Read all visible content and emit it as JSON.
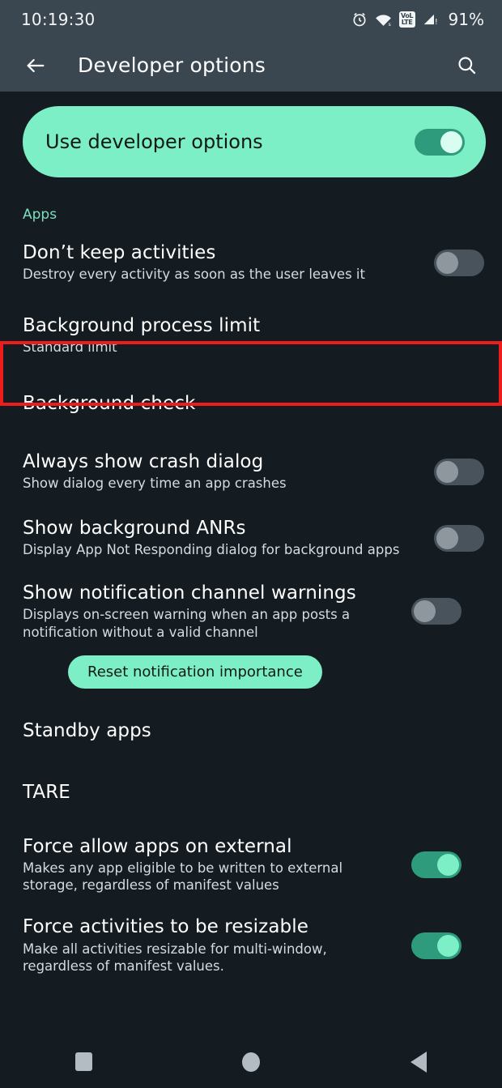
{
  "status_bar": {
    "time": "10:19:30",
    "battery": "91%",
    "icons": [
      "alarm-icon",
      "wifi-icon",
      "volte-icon",
      "signal-icon"
    ],
    "volte_top": "VoL",
    "volte_bottom": "LTE"
  },
  "app_bar": {
    "back_icon": "back-arrow-icon",
    "title": "Developer options",
    "search_icon": "search-icon"
  },
  "master_toggle": {
    "label": "Use developer options",
    "state": "on"
  },
  "sections": [
    {
      "header": "Apps"
    }
  ],
  "rows": [
    {
      "title": "Don’t keep activities",
      "summary": "Destroy every activity as soon as the user leaves it",
      "toggle": "off"
    },
    {
      "title": "Background process limit",
      "summary": "Standard limit",
      "toggle": "none",
      "highlighted": true
    },
    {
      "title": "Background check",
      "summary": "",
      "toggle": "none"
    },
    {
      "title": "Always show crash dialog",
      "summary": "Show dialog every time an app crashes",
      "toggle": "off"
    },
    {
      "title": "Show background ANRs",
      "summary": "Display App Not Responding dialog for background apps",
      "toggle": "off"
    },
    {
      "title": "Show notification channel warnings",
      "summary": "Displays on-screen warning when an app posts a notification without a valid channel",
      "toggle": "off"
    },
    {
      "title": "Standby apps",
      "summary": "",
      "toggle": "none"
    },
    {
      "title": "TARE",
      "summary": "",
      "toggle": "none"
    },
    {
      "title": "Force allow apps on external",
      "summary": "Makes any app eligible to be written to external storage, regardless of manifest values",
      "toggle": "on"
    },
    {
      "title": "Force activities to be resizable",
      "summary": "Make all activities resizable for multi-window, regardless of manifest values.",
      "toggle": "on"
    }
  ],
  "reset_button": {
    "label": "Reset notification importance"
  },
  "nav_bar": {
    "recents": "recents-square-icon",
    "home": "home-circle-icon",
    "back": "back-triangle-icon"
  },
  "colors": {
    "accent_mint": "#7defc6",
    "accent_teal_text": "#7ddfbd",
    "background": "#141c21",
    "app_bar": "#3b4750",
    "highlight_red": "#ee1c1c"
  }
}
